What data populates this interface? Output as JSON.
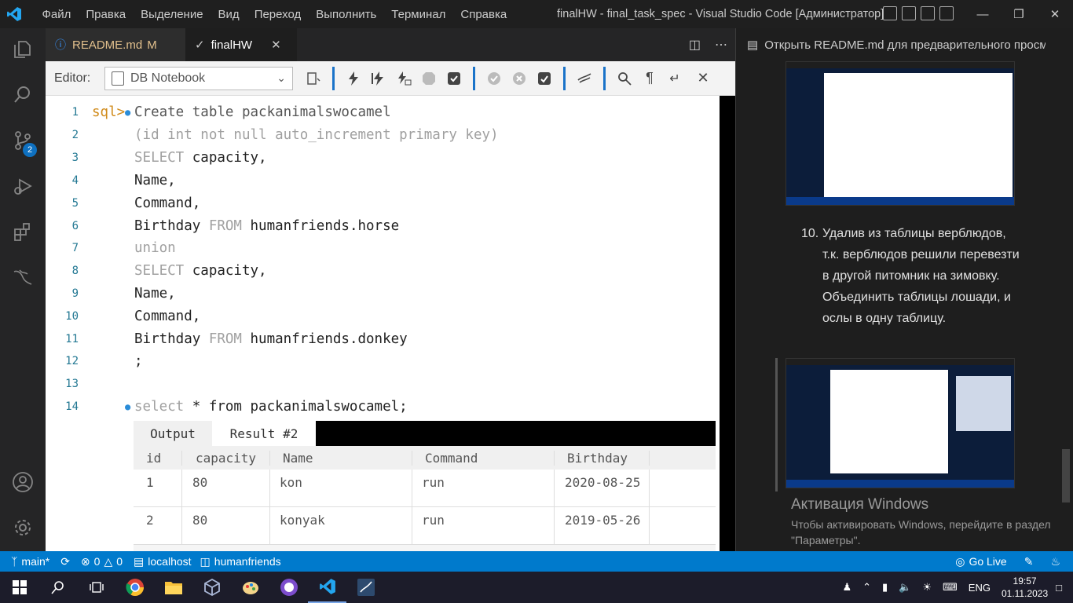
{
  "titlebar": {
    "menu": [
      "Файл",
      "Правка",
      "Выделение",
      "Вид",
      "Переход",
      "Выполнить",
      "Терминал",
      "Справка"
    ],
    "title": "finalHW - final_task_spec - Visual Studio Code [Администратор]"
  },
  "activity": {
    "source_control_badge": "2"
  },
  "tabs": [
    {
      "label": "README.md",
      "modified": "M"
    },
    {
      "label": "finalHW"
    }
  ],
  "toolbar": {
    "editor_label": "Editor:",
    "editor_value": "DB Notebook"
  },
  "code": {
    "prompt": "sql>",
    "lines": [
      {
        "n": "1",
        "text": "Create table packanimalswocamel"
      },
      {
        "n": "2",
        "text": "(id int not null auto_increment primary key)"
      },
      {
        "n": "3",
        "kw": "SELECT",
        "text": " capacity,"
      },
      {
        "n": "4",
        "text": "Name,"
      },
      {
        "n": "5",
        "text": "Command,"
      },
      {
        "n": "6",
        "pre": "Birthday ",
        "kw": "FROM",
        "text": " humanfriends.horse"
      },
      {
        "n": "7",
        "kw": "union",
        "text": ""
      },
      {
        "n": "8",
        "kw": "SELECT",
        "text": " capacity,"
      },
      {
        "n": "9",
        "text": "Name,"
      },
      {
        "n": "10",
        "text": "Command,"
      },
      {
        "n": "11",
        "pre": "Birthday ",
        "kw": "FROM",
        "text": " humanfriends.donkey"
      },
      {
        "n": "12",
        "text": ";"
      },
      {
        "n": "13",
        "text": ""
      },
      {
        "n": "14",
        "kw": "select",
        "text": " * from packanimalswocamel;"
      }
    ]
  },
  "results": {
    "tabs": [
      "Output",
      "Result #2"
    ],
    "columns": [
      "id",
      "capacity",
      "Name",
      "Command",
      "Birthday"
    ],
    "rows": [
      [
        "1",
        "80",
        "kon",
        "run",
        "2020-08-25"
      ],
      [
        "2",
        "80",
        "konyak",
        "run",
        "2019-05-26"
      ]
    ]
  },
  "preview": {
    "title": "Открыть README.md для предварительного просмотра",
    "step_number": "10.",
    "step_text": "Удалив из таблицы верблюдов, т.к. верблюдов решили перевезти в другой питомник на зимовку. Объединить таблицы лошади, и ослы в одну таблицу."
  },
  "activation": {
    "heading": "Активация Windows",
    "text": "Чтобы активировать Windows, перейдите в раздел \"Параметры\"."
  },
  "status": {
    "branch": "main*",
    "errors": "0",
    "warnings": "0",
    "host": "localhost",
    "database": "humanfriends",
    "golive": "Go Live"
  },
  "taskbar": {
    "lang": "ENG",
    "time": "19:57",
    "date": "01.11.2023"
  },
  "colors": {
    "accent": "#007acc",
    "keyword": "#a0a0a0",
    "prompt": "#d08a19"
  }
}
